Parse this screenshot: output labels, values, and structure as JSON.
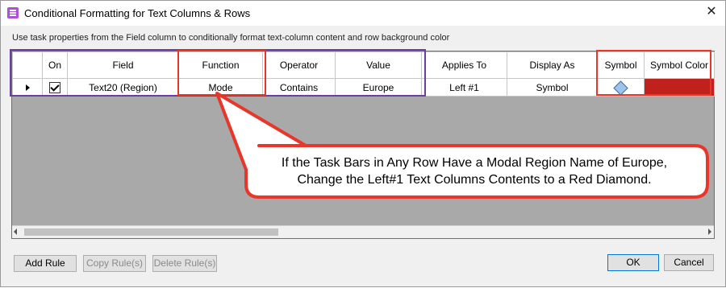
{
  "window": {
    "title": "Conditional Formatting for Text Columns & Rows",
    "close_glyph": "✕",
    "icon": "app-icon"
  },
  "instructions": "Use task properties from the Field column to conditionally format text-column content and row background color",
  "table": {
    "headers": {
      "on": "On",
      "field": "Field",
      "function": "Function",
      "operator": "Operator",
      "value": "Value",
      "applies_to": "Applies To",
      "display_as": "Display As",
      "symbol": "Symbol",
      "symbol_color": "Symbol Color"
    },
    "rows": [
      {
        "on": true,
        "field": "Text20 (Region)",
        "function": "Mode",
        "operator": "Contains",
        "value": "Europe",
        "applies_to": "Left #1",
        "display_as": "Symbol",
        "symbol": "diamond-icon",
        "symbol_color": "#c0211d"
      }
    ]
  },
  "callout": {
    "line1": "If the Task Bars in Any Row Have a Modal Region Name of Europe,",
    "line2": "Change the Left#1 Text Columns Contents to a Red Diamond."
  },
  "buttons": {
    "add_rule": "Add Rule",
    "copy_rules": "Copy Rule(s)",
    "delete_rules": "Delete Rule(s)",
    "ok": "OK",
    "cancel": "Cancel"
  },
  "colors": {
    "highlight_purple": "#6b3fa0",
    "highlight_red": "#e8362b",
    "callout_fill": "#ffffff"
  }
}
